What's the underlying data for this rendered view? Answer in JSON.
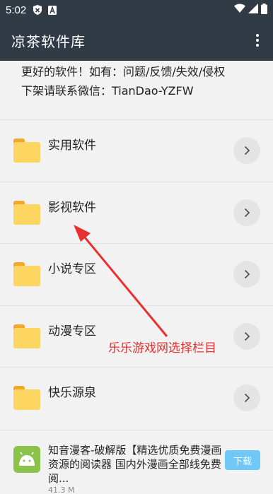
{
  "status_bar": {
    "time": "5:02",
    "icons": [
      "security-shield-icon",
      "font-a-icon",
      "wifi-icon",
      "signal-icon",
      "battery-icon"
    ]
  },
  "app_bar": {
    "title": "凉茶软件库",
    "menu_icon": "more-vert-icon"
  },
  "notice": {
    "line1": "更好的软件！如有：问题/反馈/失效/侵权",
    "line2": "下架请联系微信：TianDao-YZFW"
  },
  "categories": [
    {
      "label": "实用软件",
      "icon": "folder-icon",
      "action_icon": "chevron-right-icon"
    },
    {
      "label": "影视软件",
      "icon": "folder-icon",
      "action_icon": "chevron-right-icon"
    },
    {
      "label": "小说专区",
      "icon": "folder-icon",
      "action_icon": "chevron-right-icon"
    },
    {
      "label": "动漫专区",
      "icon": "folder-icon",
      "action_icon": "chevron-right-icon"
    },
    {
      "label": "快乐源泉",
      "icon": "folder-icon",
      "action_icon": "chevron-right-icon"
    }
  ],
  "app_item": {
    "description": "知音漫客-破解版【精选优质免费漫画资源的阅读器 国内外漫画全部线免费阅...",
    "size": "41.3 M",
    "download_label": "下载",
    "icon": "android-icon"
  },
  "annotation": {
    "text": "乐乐游戏网选择栏目",
    "color": "#e8302f"
  },
  "colors": {
    "app_bar": "#313b45",
    "folder": "#fcd660",
    "folder_tab": "#f5a72b",
    "download": "#6fc8f6",
    "android": "#8bc34a"
  }
}
